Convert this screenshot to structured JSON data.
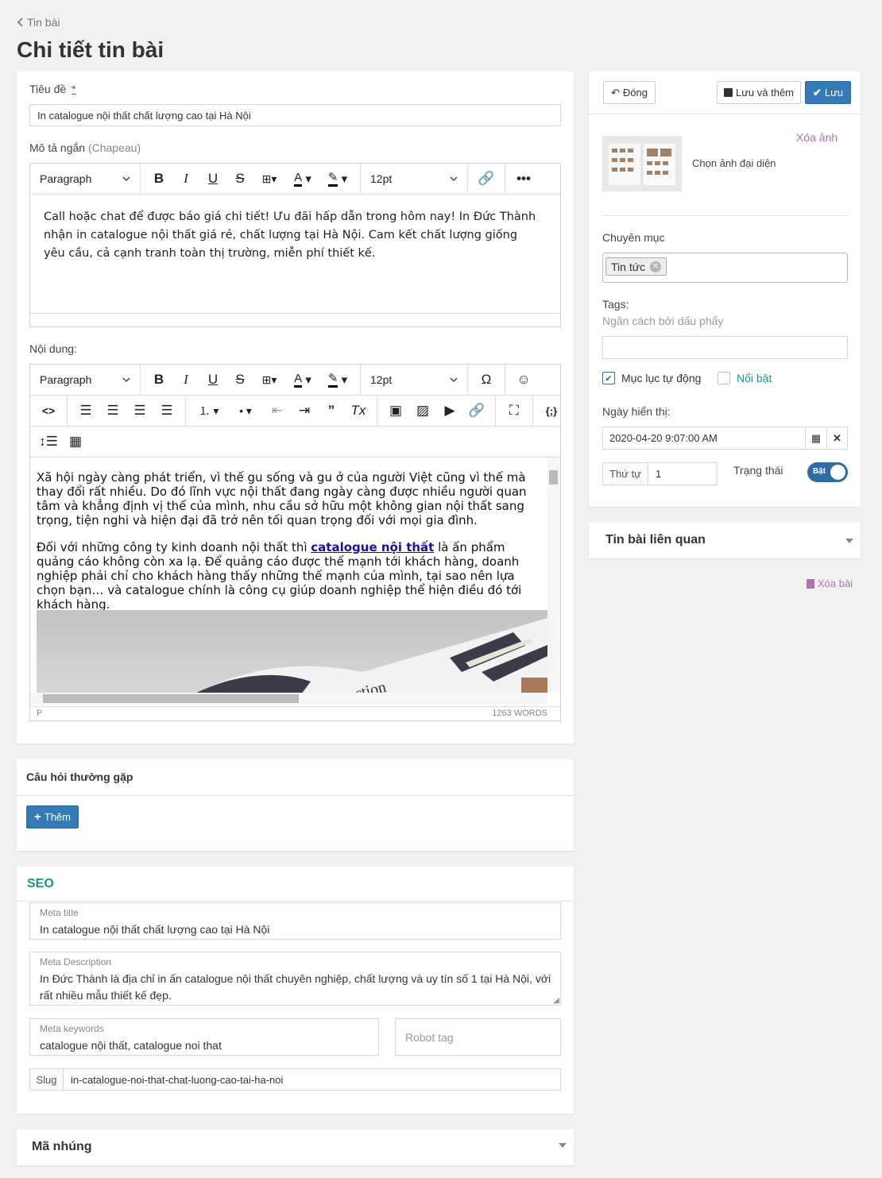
{
  "breadcrumb": "Tin bài",
  "page_title": "Chi tiết tin bài",
  "colors": {
    "primary": "#337ab7",
    "purple": "#b16fb5",
    "seo": "#16988a",
    "link": "#1a0dab"
  },
  "form": {
    "title_label": "Tiêu đề",
    "required_mark": "*",
    "title_value": "In catalogue nội thất chất lượng cao tại Hà Nội",
    "short_desc_label": "Mô tả ngắn",
    "short_desc_hint": "(Chapeau)",
    "short_desc_text": "Call hoặc chat để được báo giá chi tiết! Ưu đãi hấp dẫn trong hôm nay! In Đức Thành nhận in catalogue nội thất giá rẻ, chất lượng tại Hà Nội. Cam kết chất lượng giống yêu cầu, cả cạnh tranh toàn thị trường, miễn phí thiết kế.",
    "content_label": "Nội dung:",
    "block_format": "Paragraph",
    "font_size": "12pt",
    "content_p1": "Xã hội ngày càng phát triển, vì thế gu sống và gu ở của người Việt cũng vì thế mà thay đổi rất nhiều. Do đó lĩnh vực nội thất đang ngày càng được nhiều người quan tâm và khẳng định vị thế của mình, nhu cầu sở hữu một không gian nội thất sang trọng, tiện nghi và hiện đại đã trở nên tối quan trọng đối với mọi gia đình.",
    "content_p2_before": "Đối với những công ty kinh doanh nội thất thì ",
    "content_p2_link": "catalogue nội thất",
    "content_p2_after": " là ấn phẩm quảng cáo không còn xa lạ. Để quảng cáo được thế mạnh tới khách hàng, doanh nghiệp phải chỉ cho khách hàng thấy những thế mạnh của mình, tại sao nên lựa chọn bạn… và catalogue chính là công cụ giúp doanh nghiệp thể hiện điều đó tới khách hàng.",
    "image_caption_text": "ction",
    "status_path": "P",
    "word_count": "1263 WORDS"
  },
  "faq": {
    "title": "Câu hỏi thường gặp",
    "add_label": "Thêm"
  },
  "seo": {
    "title": "SEO",
    "meta_title_label": "Meta title",
    "meta_title": "In catalogue nội thất chất lượng cao tại Hà Nội",
    "meta_desc_label": "Meta Description",
    "meta_desc": "In Đức Thành là địa chỉ in ấn catalogue nội thất chuyên nghiệp, chất lượng và uy tín số 1 tại Hà Nội, với rất nhiều mẫu thiết kế đẹp.",
    "meta_kw_label": "Meta keywords",
    "meta_kw": "catalogue nội thất, catalogue noi that",
    "robot_placeholder": "Robot tag",
    "slug_label": "Slug",
    "slug": "in-catalogue-noi-that-chat-luong-cao-tai-ha-noi"
  },
  "embed": {
    "title": "Mã nhúng"
  },
  "sidebar": {
    "close": "Đóng",
    "save_add": "Lưu và thêm",
    "save": "Lưu",
    "remove_image": "Xóa ảnh",
    "choose_image": "Chọn ảnh đại diện",
    "category_label": "Chuyên mục",
    "category_tag": "Tin tức",
    "tags_label": "Tags:",
    "tags_hint": "Ngăn cách bởi dấu phẩy",
    "toc_label": "Mục lục tự động",
    "toc_checked": true,
    "featured_label": "Nổi bật",
    "featured_checked": false,
    "date_label": "Ngày hiển thị:",
    "date_value": "2020-04-20 9:07:00 AM",
    "order_label": "Thứ tự",
    "order_value": "1",
    "status_label": "Trạng thái",
    "toggle_label": "Bật",
    "toggle_on": true,
    "related_title": "Tin bài liên quan",
    "delete_post": "Xóa bài"
  }
}
